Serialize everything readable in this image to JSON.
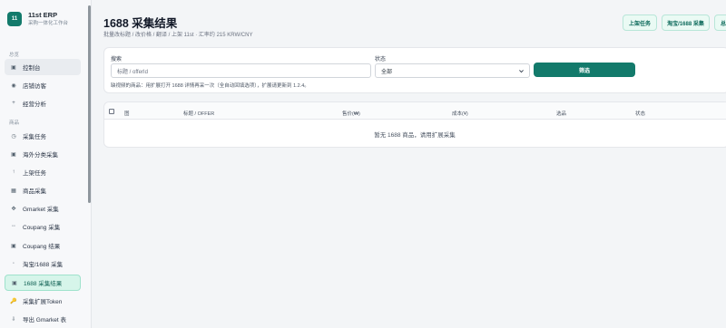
{
  "brand": {
    "logo": "11",
    "title": "11st ERP",
    "subtitle": "采购一体化工作台"
  },
  "sections": {
    "overview": "总览",
    "products": "商品"
  },
  "nav": [
    {
      "label": "控制台",
      "icon": "▣"
    },
    {
      "label": "店铺访客",
      "icon": "◉"
    },
    {
      "label": "经营分析",
      "icon": "+"
    },
    {
      "label": "采集任务",
      "icon": "◷"
    },
    {
      "label": "海外分类采集",
      "icon": "▣"
    },
    {
      "label": "上架任务",
      "icon": "↑"
    },
    {
      "label": "商品采集",
      "icon": "▦"
    },
    {
      "label": "Gmarket 采集",
      "icon": "✥"
    },
    {
      "label": "Coupang 采集",
      "icon": "◦◦"
    },
    {
      "label": "Coupang 结果",
      "icon": "▣"
    },
    {
      "label": "淘宝/1688 采集",
      "icon": "◦"
    },
    {
      "label": "1688 采集结果",
      "icon": "▣"
    },
    {
      "label": "采集扩展Token",
      "icon": "🔑"
    },
    {
      "label": "导出 Gmarket 表",
      "icon": "⇩"
    }
  ],
  "header": {
    "title": "1688 采集结果",
    "subtitle": "批量改标题 / 改价格 / 翻译 / 上架 11st · 汇率约 215 KRW/CNY",
    "buttons": [
      "上架任务",
      "淘宝/1688 采集",
      "总"
    ]
  },
  "filter": {
    "search_label": "搜索",
    "search_placeholder": "标题 / offerId",
    "status_label": "状态",
    "status_value": "全部",
    "filter_button": "筛选",
    "hint": "缺视频的商品：用扩展打开 1688 详情再采一次（全自动回填选项），扩展请更新到 1.2.4。"
  },
  "table": {
    "columns": [
      "图",
      "标题 / OFFER",
      "售价(₩)",
      "成本(¥)",
      "选品",
      "状态"
    ],
    "empty": "暂无 1688 商品，请用扩展采集"
  }
}
